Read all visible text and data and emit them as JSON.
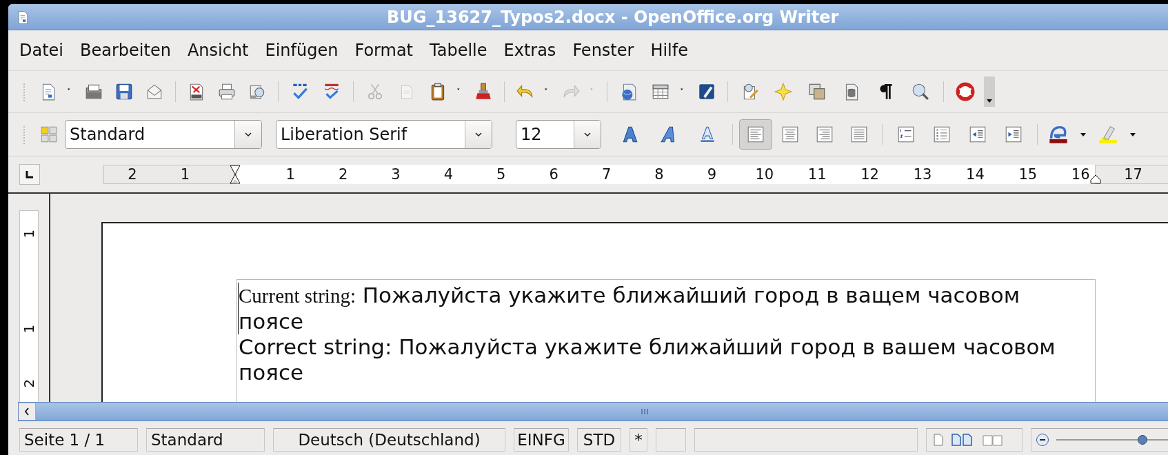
{
  "window": {
    "title": "BUG_13627_Typos2.docx - OpenOffice.org Writer"
  },
  "menu": [
    {
      "label": "Datei"
    },
    {
      "label": "Bearbeiten"
    },
    {
      "label": "Ansicht"
    },
    {
      "label": "Einfügen"
    },
    {
      "label": "Format"
    },
    {
      "label": "Tabelle"
    },
    {
      "label": "Extras"
    },
    {
      "label": "Fenster"
    },
    {
      "label": "Hilfe"
    }
  ],
  "format_toolbar": {
    "paragraph_style": "Standard",
    "font_name": "Liberation Serif",
    "font_size": "12",
    "alignment": [
      {
        "selected": true
      },
      {
        "selected": false
      },
      {
        "selected": false
      },
      {
        "selected": false
      }
    ]
  },
  "ruler": {
    "left_labels": [
      "2",
      "1"
    ],
    "labels": [
      "1",
      "2",
      "3",
      "4",
      "5",
      "6",
      "7",
      "8",
      "9",
      "10",
      "11",
      "12",
      "13",
      "14",
      "15",
      "16",
      "17"
    ]
  },
  "vertical_ruler": {
    "labels": [
      "1",
      "1",
      "2"
    ]
  },
  "document": {
    "paragraphs": [
      {
        "label": "Current string:",
        "kind": "serif_label",
        "text": "Пожалуйста укажите ближайший город в ващем часовом поясе"
      },
      {
        "label": "Correct string:",
        "kind": "sans_label",
        "text": "Пожалуйста укажите ближайший город в вашем часовом поясе"
      }
    ]
  },
  "status_bar": {
    "page": "Seite 1 / 1",
    "page_style": "Standard",
    "language": "Deutsch (Deutschland)",
    "insert_mode": "EINFG",
    "selection_mode": "STD",
    "modified": "*"
  },
  "zoom_slider": {
    "level": 0.5
  }
}
